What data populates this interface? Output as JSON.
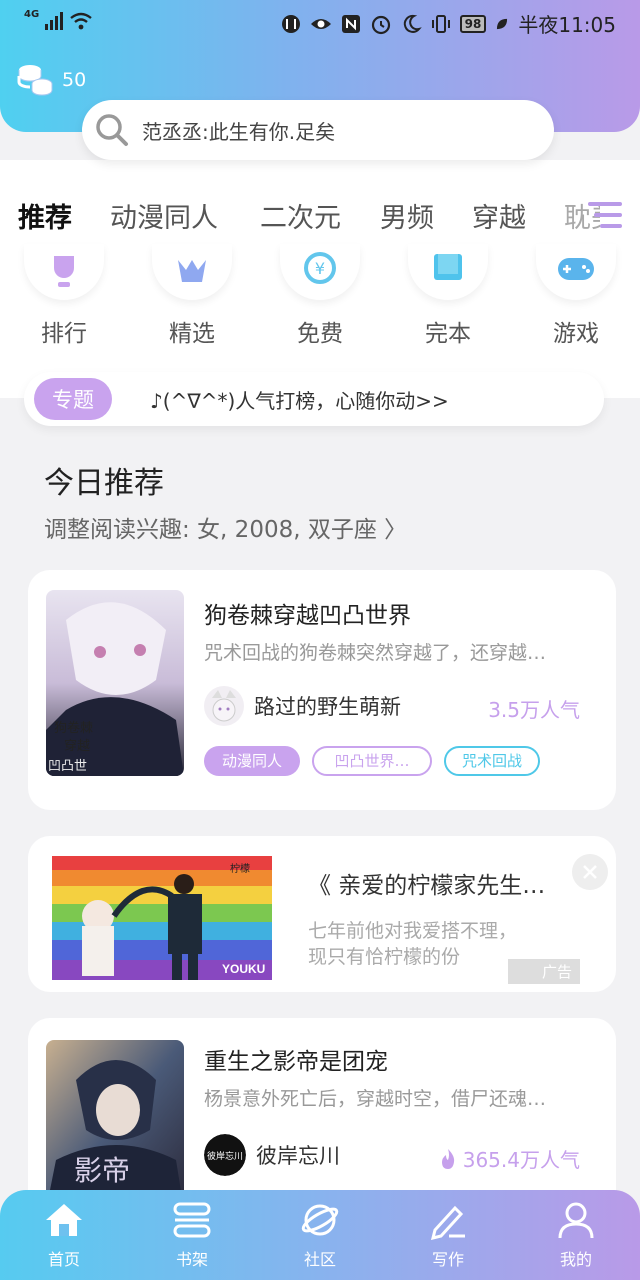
{
  "status_bar": {
    "network": "4G",
    "battery": "98",
    "time": "半夜11:05"
  },
  "header": {
    "coins": "50"
  },
  "search": {
    "placeholder": "范丞丞:此生有你.足矣"
  },
  "tabs": [
    {
      "label": "推荐",
      "active": true
    },
    {
      "label": "动漫同人"
    },
    {
      "label": "二次元"
    },
    {
      "label": "男频"
    },
    {
      "label": "穿越"
    },
    {
      "label": "耽美"
    }
  ],
  "quick_links": [
    {
      "label": "排行",
      "icon": "trophy-icon"
    },
    {
      "label": "精选",
      "icon": "crown-icon"
    },
    {
      "label": "免费",
      "icon": "yen-icon"
    },
    {
      "label": "完本",
      "icon": "book-icon"
    },
    {
      "label": "游戏",
      "icon": "gamepad-icon"
    }
  ],
  "topic": {
    "badge": "专题",
    "text": "♪(^∇^*)人气打榜，心随你动>>"
  },
  "today": {
    "title": "今日推荐",
    "subtitle": "调整阅读兴趣: 女, 2008, 双子座 〉"
  },
  "books": [
    {
      "title": "狗卷棘穿越凹凸世界",
      "description": "咒术回战的狗卷棘突然穿越了，还穿越…",
      "author": "路过的野生萌新",
      "popularity": "3.5万人气",
      "tags": [
        "动漫同人",
        "凹凸世界…",
        "咒术回战"
      ]
    },
    {
      "title": "重生之影帝是团宠",
      "description": "杨景意外死亡后，穿越时空，借尸还魂…",
      "author": "彼岸忘川",
      "popularity": "365.4万人气"
    }
  ],
  "ad": {
    "title": "《 亲爱的柠檬家先生…",
    "description_line1": "七年前他对我爱搭不理，",
    "description_line2": "现只有恰柠檬的份",
    "mark": "广告",
    "brand": "YOUKU"
  },
  "bottom_nav": [
    {
      "label": "首页",
      "icon": "home-icon"
    },
    {
      "label": "书架",
      "icon": "bookshelf-icon"
    },
    {
      "label": "社区",
      "icon": "planet-icon"
    },
    {
      "label": "写作",
      "icon": "pen-icon"
    },
    {
      "label": "我的",
      "icon": "user-icon"
    }
  ],
  "colors": {
    "accent": "#c6a0ec",
    "cyan": "#4fd0f0",
    "tag_purple": "#c9a3ee",
    "tag_cyan": "#4fc8e8"
  }
}
